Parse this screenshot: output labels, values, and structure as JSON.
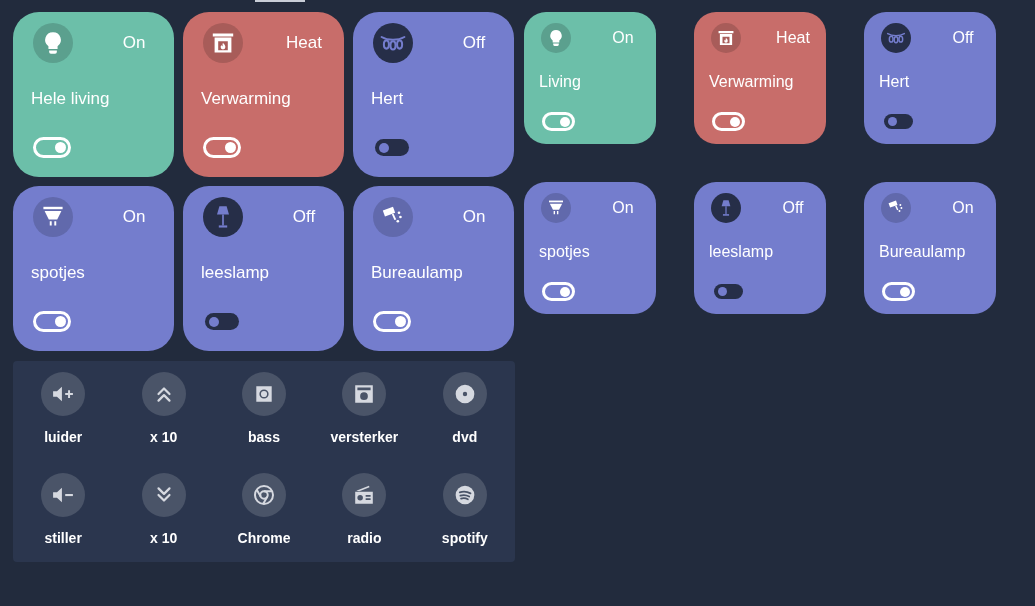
{
  "large_tiles": [
    {
      "name": "Hele living",
      "state": "On",
      "on": true,
      "color": "#6cbfa9"
    },
    {
      "name": "Verwarming",
      "state": "Heat",
      "on": true,
      "color": "#c86d6a"
    },
    {
      "name": "Hert",
      "state": "Off",
      "on": false,
      "color": "#747dcd"
    },
    {
      "name": "spotjes",
      "state": "On",
      "on": true,
      "color": "#747dcd"
    },
    {
      "name": "leeslamp",
      "state": "Off",
      "on": false,
      "color": "#747dcd"
    },
    {
      "name": "Bureaulamp",
      "state": "On",
      "on": true,
      "color": "#747dcd"
    }
  ],
  "small_tiles": [
    {
      "name": "Living",
      "state": "On",
      "on": true,
      "color": "#6cbfa9"
    },
    {
      "name": "Verwarming",
      "state": "Heat",
      "on": true,
      "color": "#c86d6a"
    },
    {
      "name": "Hert",
      "state": "Off",
      "on": false,
      "color": "#747dcd"
    },
    {
      "name": "spotjes",
      "state": "On",
      "on": true,
      "color": "#747dcd"
    },
    {
      "name": "leeslamp",
      "state": "Off",
      "on": false,
      "color": "#747dcd"
    },
    {
      "name": "Bureaulamp",
      "state": "On",
      "on": true,
      "color": "#747dcd"
    }
  ],
  "remote": {
    "buttons": [
      {
        "label": "luider"
      },
      {
        "label": "x 10"
      },
      {
        "label": "bass"
      },
      {
        "label": "versterker"
      },
      {
        "label": "dvd"
      },
      {
        "label": "stiller"
      },
      {
        "label": "x 10"
      },
      {
        "label": "Chrome"
      },
      {
        "label": "radio"
      },
      {
        "label": "spotify"
      }
    ]
  }
}
